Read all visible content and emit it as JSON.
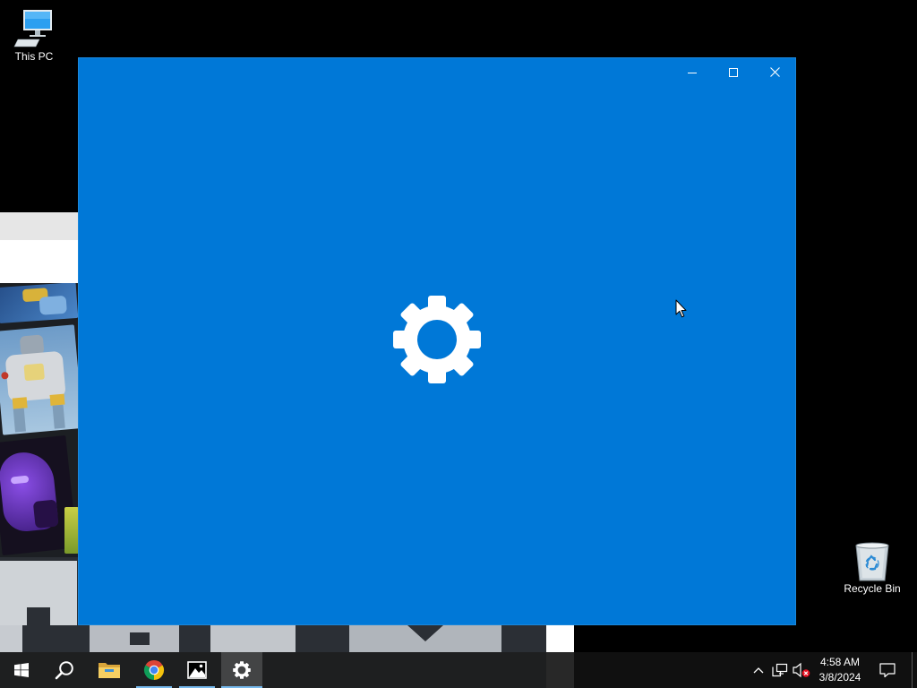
{
  "desktop": {
    "this_pc": {
      "label": "This PC",
      "icon": "computer-icon"
    },
    "recycle_bin": {
      "label": "Recycle Bin",
      "icon": "recycle-bin-icon"
    }
  },
  "settings_window": {
    "splash_icon": "gear-icon",
    "controls": {
      "minimize": "minimize-icon",
      "maximize": "maximize-icon",
      "close": "close-icon"
    }
  },
  "taskbar": {
    "start": {
      "icon": "windows-logo-icon"
    },
    "search": {
      "icon": "search-icon"
    },
    "apps": [
      {
        "icon": "file-explorer-icon",
        "running": false,
        "active": false
      },
      {
        "icon": "chrome-icon",
        "running": true,
        "active": false
      },
      {
        "icon": "photos-icon",
        "running": true,
        "active": false
      },
      {
        "icon": "settings-icon",
        "running": true,
        "active": true
      }
    ],
    "tray": {
      "icons": [
        "chevron-up-icon",
        "network-icon",
        "volume-muted-icon"
      ],
      "time": "4:58 AM",
      "date": "3/8/2024",
      "notification_icon": "notification-icon"
    }
  },
  "cursor": {
    "icon": "mouse-pointer-icon"
  },
  "colors": {
    "settings_splash": "#0078D7",
    "desktop": "#000000",
    "taskbar": "#101010",
    "running_indicator": "#76B9ED",
    "muted_badge": "#E81123"
  }
}
